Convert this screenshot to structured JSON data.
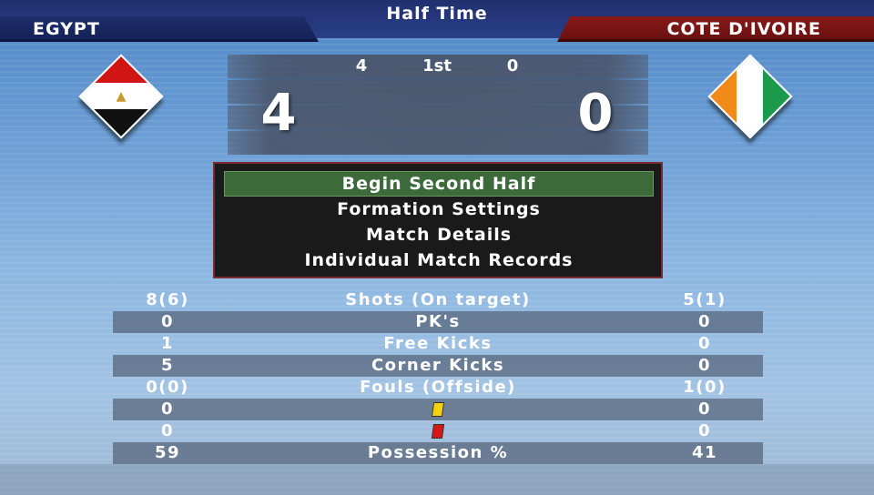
{
  "header": {
    "title": "Half Time"
  },
  "teams": {
    "home": {
      "name": "EGYPT",
      "flag_icon": "egypt-flag-icon"
    },
    "away": {
      "name": "COTE D'IVOIRE",
      "flag_icon": "cote-divoire-flag-icon"
    }
  },
  "score": {
    "half_label": "1st",
    "half_home": "4",
    "half_away": "0",
    "home": "4",
    "away": "0"
  },
  "menu": {
    "items": [
      {
        "label": "Begin Second Half",
        "selected": true
      },
      {
        "label": "Formation Settings",
        "selected": false
      },
      {
        "label": "Match Details",
        "selected": false
      },
      {
        "label": "Individual Match Records",
        "selected": false
      }
    ]
  },
  "stats": [
    {
      "home": "8(6)",
      "label": "Shots (On target)",
      "away": "5(1)"
    },
    {
      "home": "0",
      "label": "PK's",
      "away": "0"
    },
    {
      "home": "1",
      "label": "Free Kicks",
      "away": "0"
    },
    {
      "home": "5",
      "label": "Corner Kicks",
      "away": "0"
    },
    {
      "home": "0(0)",
      "label": "Fouls (Offside)",
      "away": "1(0)"
    },
    {
      "home": "0",
      "icon": "yellow-card-icon",
      "away": "0"
    },
    {
      "home": "0",
      "icon": "red-card-icon",
      "away": "0"
    },
    {
      "home": "59",
      "label": "Possession %",
      "away": "41"
    }
  ],
  "colors": {
    "home_banner": "#1e2e6c",
    "away_banner": "#8a1a1a",
    "menu_selected": "#3c6a3a"
  }
}
